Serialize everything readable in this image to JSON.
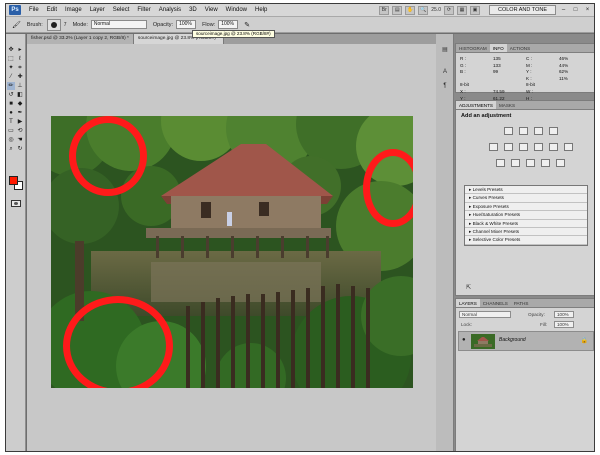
{
  "app": {
    "logo": "Ps"
  },
  "menu": [
    "File",
    "Edit",
    "Image",
    "Layer",
    "Select",
    "Filter",
    "Analysis",
    "3D",
    "View",
    "Window",
    "Help"
  ],
  "menubar_right": {
    "zoom": "25.0",
    "workspace": "COLOR AND TONE",
    "minimize": "–",
    "restore": "□",
    "close": "×"
  },
  "options": {
    "brush_label": "Brush:",
    "brush_size": "7",
    "mode_label": "Mode:",
    "mode_value": "Normal",
    "opacity_label": "Opacity:",
    "opacity_value": "100%",
    "flow_label": "Flow:",
    "flow_value": "100%"
  },
  "tooltip": "sourceimage.jpg @ 23.8% (RGB/8#)",
  "tabs": [
    "fisher.psd @ 33.2% (Layer 1 copy 2, RGB/8) *",
    "sourceimage.jpg @ 23.8% (RGB/8#) *"
  ],
  "info_panel": {
    "tabs": [
      "HISTOGRAM",
      "INFO",
      "ACTIONS"
    ],
    "rows": [
      [
        "R :",
        "135",
        "C :",
        "46%"
      ],
      [
        "G :",
        "133",
        "M :",
        "44%"
      ],
      [
        "B :",
        "99",
        "Y :",
        "62%"
      ],
      [
        "",
        "",
        "K :",
        "11%"
      ],
      [
        "8-bit",
        "",
        "8-bit",
        ""
      ],
      [
        "X :",
        "74.59",
        "W :",
        ""
      ],
      [
        "Y :",
        "61.22",
        "H :",
        ""
      ]
    ]
  },
  "adjustments": {
    "tabs": [
      "ADJUSTMENTS",
      "MASKS"
    ],
    "title": "Add an adjustment",
    "presets": [
      "Levels Presets",
      "Curves Presets",
      "Exposure Presets",
      "Hue/Saturation Presets",
      "Black & White Presets",
      "Channel Mixer Presets",
      "Selective Color Presets"
    ]
  },
  "layers": {
    "tabs": [
      "LAYERS",
      "CHANNELS",
      "PATHS"
    ],
    "blend_mode": "Normal",
    "opacity_label": "Opacity:",
    "opacity": "100%",
    "fill_label": "Fill:",
    "fill": "100%",
    "lock_label": "Lock:",
    "layer_name": "Background",
    "eye": "●",
    "lock": "🔒"
  },
  "colors": {
    "foreground": "#ff1a00",
    "background": "#ffffff",
    "annotation": "#ff1a1a"
  },
  "icons": [
    "photoshop-logo",
    "brush-tool-icon",
    "move-tool-icon",
    "marquee-icon",
    "lasso-icon",
    "eyedropper-icon",
    "gear-icon",
    "hand-icon",
    "zoom-icon"
  ]
}
